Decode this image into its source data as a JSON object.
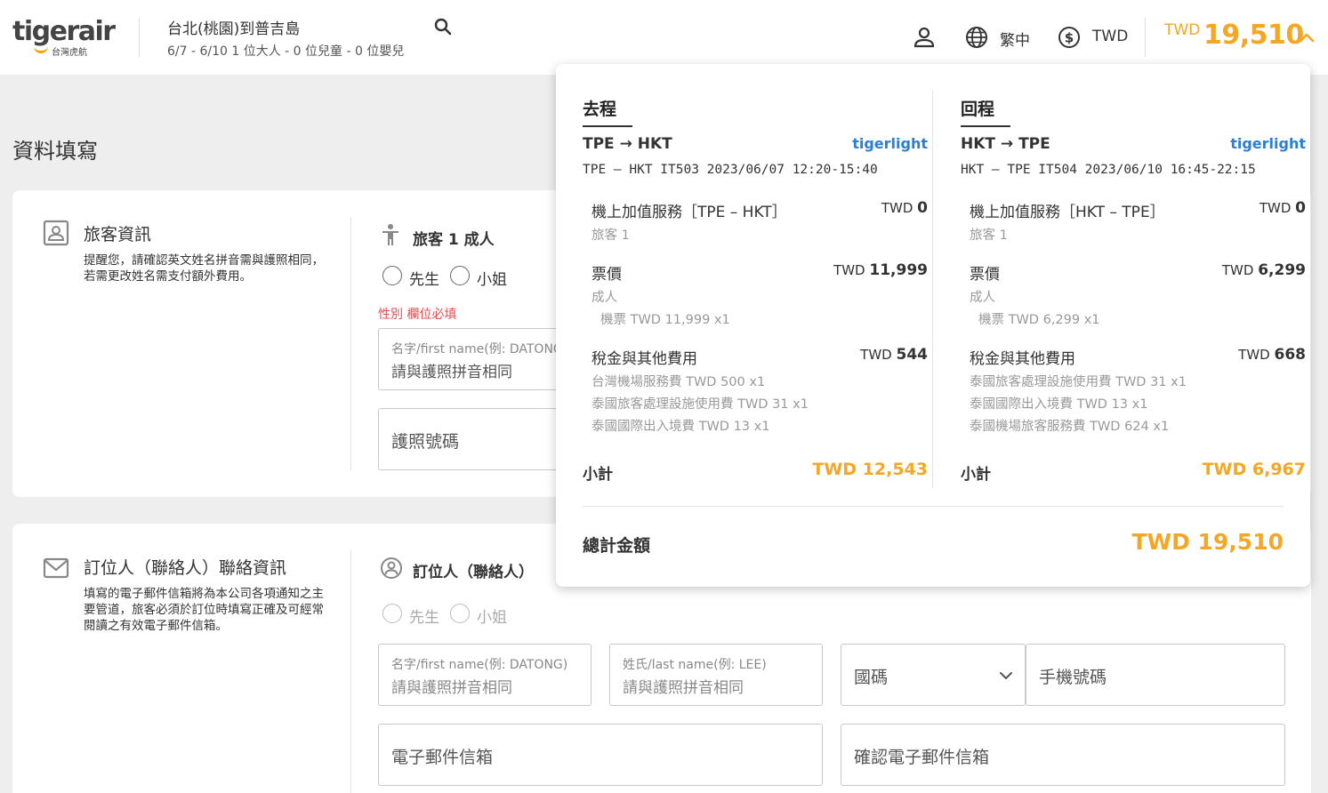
{
  "header": {
    "logo_text": "tigerair",
    "logo_sub": "台灣虎航",
    "route_title": "台北(桃園)到普吉島",
    "route_sub": "6/7 - 6/10  1 位大人 - 0 位兒童 - 0 位嬰兒",
    "language": "繁中",
    "currency": "TWD",
    "total_currency": "TWD",
    "total_amount": "19,510",
    "accent_color": "#f5a623"
  },
  "page_title": "資料填寫",
  "traveler_section": {
    "title": "旅客資訊",
    "desc": "提醒您，請確認英文姓名拼音需與護照相同，若需更改姓名需支付額外費用。",
    "pax_title": "旅客 1 成人",
    "options": [
      "先生",
      "小姐"
    ],
    "required_text": "性別 欄位必填",
    "first_name_label": "名字/first name(例: DATONG)",
    "first_name_value": "請與護照拼音相同",
    "passport_placeholder": "護照號碼"
  },
  "contact_section": {
    "title": "訂位人（聯絡人）聯絡資訊",
    "desc": "填寫的電子郵件信箱將為本公司各項通知之主要管道，旅客必須於訂位時填寫正確及可經常閱讀之有效電子郵件信箱。",
    "pax_title": "訂位人（聯絡人）",
    "options": [
      "先生",
      "小姐"
    ],
    "first_name_label": "名字/first name(例: DATONG)",
    "first_name_value": "請與護照拼音相同",
    "last_name_label": "姓氏/last name(例: LEE)",
    "last_name_value": "請與護照拼音相同",
    "country_code": "國碼",
    "mobile_placeholder": "手機號碼",
    "email_placeholder": "電子郵件信箱",
    "email_confirm_placeholder": "確認電子郵件信箱"
  },
  "price_popup": {
    "outbound": {
      "title": "去程",
      "leg": "TPE → HKT",
      "brand": "tigerlight",
      "flight": "TPE – HKT  IT503 2023/06/07 12:20-15:40",
      "addon_label": "機上加值服務［TPE – HKT］",
      "addon_curr": "TWD",
      "addon_amt": "0",
      "addon_sub": "旅客 1",
      "fare_label": "票價",
      "fare_curr": "TWD",
      "fare_amt": "11,999",
      "fare_sub1": "成人",
      "fare_sub2": "機票 TWD 11,999 x1",
      "tax_label": "稅金與其他費用",
      "tax_curr": "TWD",
      "tax_amt": "544",
      "tax_items": [
        "台灣機場服務費 TWD 500 x1",
        "泰國旅客處理設施使用費 TWD 31 x1",
        "泰國國際出入境費 TWD 13 x1"
      ],
      "subtotal_label": "小計",
      "subtotal_amt": "TWD 12,543"
    },
    "inbound": {
      "title": "回程",
      "leg": "HKT → TPE",
      "brand": "tigerlight",
      "flight": "HKT – TPE  IT504 2023/06/10 16:45-22:15",
      "addon_label": "機上加值服務［HKT – TPE］",
      "addon_curr": "TWD",
      "addon_amt": "0",
      "addon_sub": "旅客 1",
      "fare_label": "票價",
      "fare_curr": "TWD",
      "fare_amt": "6,299",
      "fare_sub1": "成人",
      "fare_sub2": "機票 TWD 6,299 x1",
      "tax_label": "稅金與其他費用",
      "tax_curr": "TWD",
      "tax_amt": "668",
      "tax_items": [
        "泰國旅客處理設施使用費 TWD 31 x1",
        "泰國國際出入境費 TWD 13 x1",
        "泰國機場旅客服務費 TWD 624 x1"
      ],
      "subtotal_label": "小計",
      "subtotal_amt": "TWD 6,967"
    },
    "grand_label": "總計金額",
    "grand_amt": "TWD 19,510"
  }
}
